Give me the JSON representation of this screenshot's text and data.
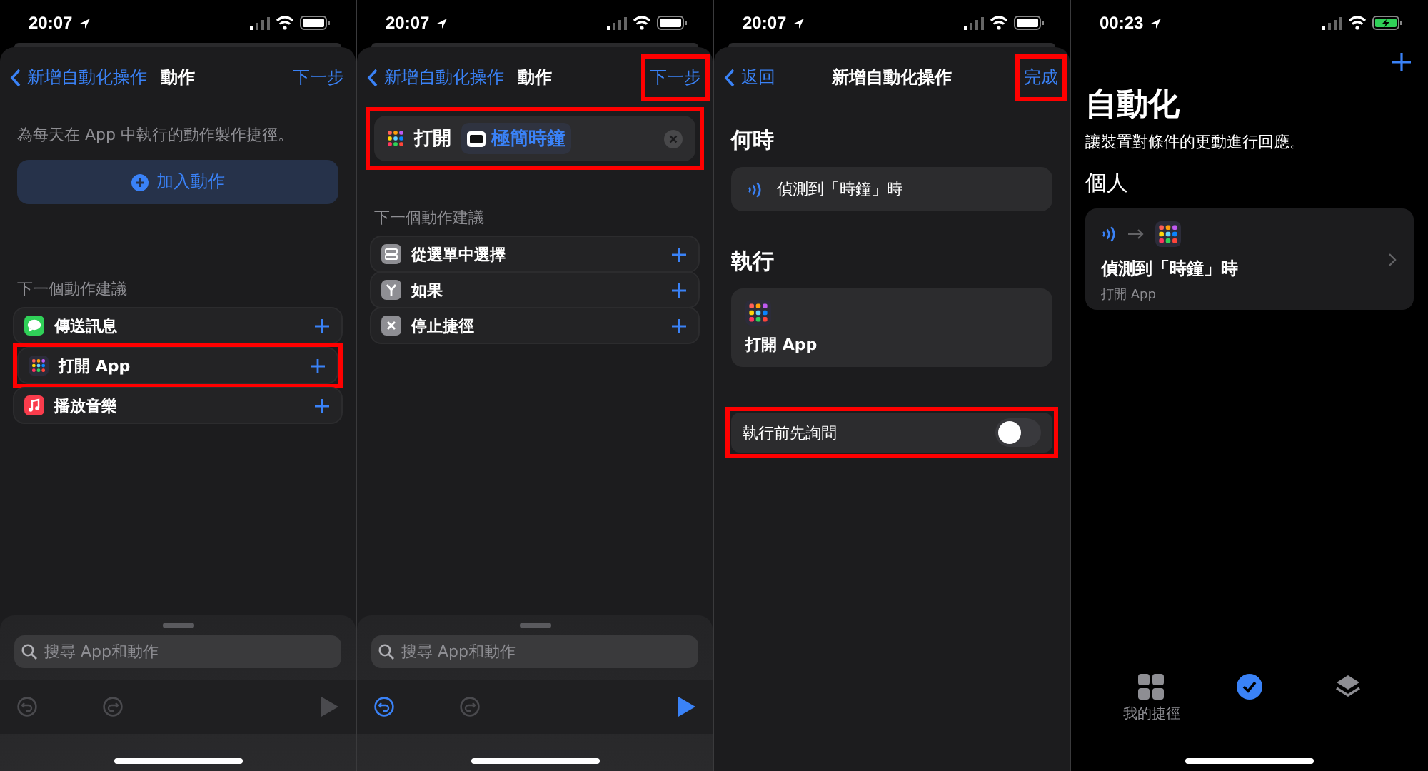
{
  "screens": [
    {
      "kind": "actions",
      "status": {
        "time": "20:07",
        "charging": false
      },
      "nav": {
        "back": "新增自動化操作",
        "title": "動作",
        "action": "下一步",
        "action_highlighted": false
      },
      "intro": "為每天在 App 中執行的動作製作捷徑。",
      "add_button": "加入動作",
      "suggestions_title": "下一個動作建議",
      "suggestions": [
        {
          "label": "傳送訊息",
          "kind": "message",
          "highlighted": false
        },
        {
          "label": "打開 App",
          "kind": "apps",
          "highlighted": true
        },
        {
          "label": "播放音樂",
          "kind": "music",
          "highlighted": false
        }
      ],
      "search": {
        "placeholder": "搜尋 App和動作"
      },
      "toolbar": {
        "undo_enabled": false,
        "play_enabled": false
      }
    },
    {
      "kind": "actions",
      "status": {
        "time": "20:07",
        "charging": false
      },
      "nav": {
        "back": "新增自動化操作",
        "title": "動作",
        "action": "下一步",
        "action_highlighted": true
      },
      "action_card": {
        "verb": "打開",
        "app": "極簡時鐘",
        "highlighted": true
      },
      "suggestions_title": "下一個動作建議",
      "suggestions": [
        {
          "label": "從選單中選擇",
          "kind": "menu",
          "highlighted": false
        },
        {
          "label": "如果",
          "kind": "if",
          "highlighted": false
        },
        {
          "label": "停止捷徑",
          "kind": "stop",
          "highlighted": false
        }
      ],
      "search": {
        "placeholder": "搜尋 App和動作"
      },
      "toolbar": {
        "undo_enabled": true,
        "play_enabled": true
      }
    },
    {
      "kind": "editor",
      "status": {
        "time": "20:07",
        "charging": false
      },
      "nav": {
        "back": "返回",
        "title": "新增自動化操作",
        "action": "完成",
        "action_highlighted": true
      },
      "when_title": "何時",
      "trigger": "偵測到「時鐘」時",
      "do_title": "執行",
      "do_action": "打開 App",
      "ask": {
        "label": "執行前先詢問",
        "on": false,
        "highlighted": true
      }
    },
    {
      "kind": "list",
      "status": {
        "time": "00:23",
        "charging": true
      },
      "title": "自動化",
      "subtitle": "讓裝置對條件的更動進行回應。",
      "section": "個人",
      "card": {
        "title": "偵測到「時鐘」時",
        "subtitle": "打開 App"
      },
      "tabs": [
        {
          "label": "我的捷徑",
          "kind": "grid",
          "selected": false
        },
        {
          "kind": "check",
          "selected": true
        },
        {
          "kind": "layers",
          "selected": false
        }
      ]
    }
  ]
}
